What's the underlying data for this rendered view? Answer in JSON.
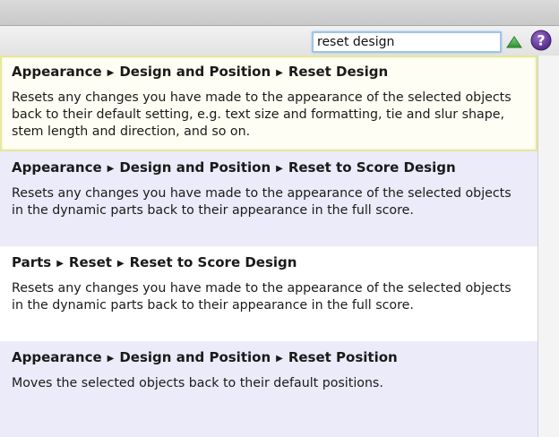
{
  "search": {
    "value": "reset design"
  },
  "toolbar": {
    "up_icon": "green-up-triangle-icon",
    "help_icon": "help-question-icon",
    "up_color": "#3aa63a",
    "help_color": "#6b3fa0"
  },
  "results": [
    {
      "path": [
        "Appearance",
        "Design and Position",
        "Reset Design"
      ],
      "description": "Resets any changes you have made to the appearance of the selected objects back to their default setting, e.g. text size and formatting, tie and slur shape, stem length and direction, and so on."
    },
    {
      "path": [
        "Appearance",
        "Design and Position",
        "Reset to Score Design"
      ],
      "description": "Resets any changes you have made to the appearance of the selected objects in the dynamic parts back to their appearance in the full score."
    },
    {
      "path": [
        "Parts",
        "Reset",
        "Reset to Score Design"
      ],
      "description": "Resets any changes you have made to the appearance of the selected objects in the dynamic parts back to their appearance in the full score."
    },
    {
      "path": [
        "Appearance",
        "Design and Position",
        "Reset Position"
      ],
      "description": "Moves the selected objects back to their default positions."
    }
  ],
  "separator": "▶"
}
